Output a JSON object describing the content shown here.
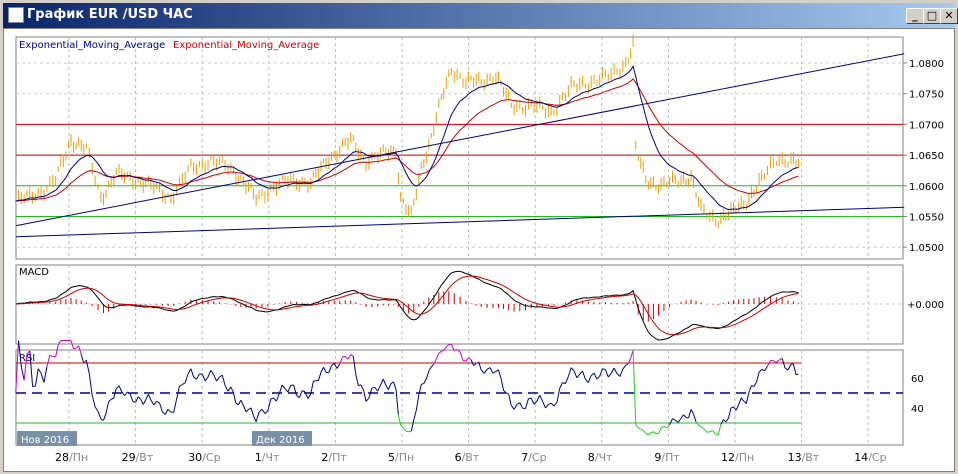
{
  "window": {
    "title": "График EUR /USD  ЧАС",
    "minimize": "_",
    "maximize": "□",
    "close": "✕"
  },
  "legend": {
    "ema_fast": "Exponential_Moving_Average",
    "ema_slow": "Exponential_Moving_Average"
  },
  "colors": {
    "price": "#e8a000",
    "ema_fast": "#000080",
    "ema_slow": "#cc0000",
    "resistance": "#cc0000",
    "support": "#22bb22",
    "trend": "#000080"
  },
  "chart_data": {
    "type": "line",
    "symbol": "EUR/USD",
    "timeframe": "H1",
    "price_ylim": [
      1.049,
      1.084
    ],
    "price_ticks": [
      "1.0800",
      "1.0750",
      "1.0700",
      "1.0650",
      "1.0600",
      "1.0550",
      "1.0500"
    ],
    "price_tick_values": [
      1.08,
      1.075,
      1.07,
      1.065,
      1.06,
      1.055,
      1.05
    ],
    "resistance_levels": [
      1.07,
      1.065
    ],
    "support_levels": [
      1.06,
      1.055
    ],
    "trendlines": [
      {
        "t": [
          -0.8,
          12.54
        ],
        "p": [
          1.0535,
          1.0815
        ]
      },
      {
        "t": [
          -0.8,
          12.54
        ],
        "p": [
          1.0517,
          1.0565
        ]
      }
    ],
    "price_t": [
      -0.8,
      -0.42,
      -0.2,
      0.03,
      0.26,
      0.48,
      0.71,
      1.0,
      1.23,
      1.53,
      1.83,
      2.13,
      2.43,
      2.58,
      2.81,
      3.03,
      3.33,
      3.63,
      3.86,
      4.23,
      4.46,
      4.68,
      4.91,
      4.98,
      5.14,
      5.29,
      5.44,
      5.59,
      5.74,
      5.96,
      6.19,
      6.41,
      6.64,
      6.94,
      7.24,
      7.54,
      7.84,
      8.14,
      8.36,
      8.47,
      8.51,
      8.66,
      8.89,
      9.19,
      9.34,
      9.49,
      9.71,
      9.94,
      10.17,
      10.4,
      10.62,
      10.84,
      10.99
    ],
    "price": [
      1.0575,
      1.059,
      1.061,
      1.0675,
      1.066,
      1.058,
      1.062,
      1.061,
      1.06,
      1.058,
      1.063,
      1.064,
      1.063,
      1.061,
      1.058,
      1.0595,
      1.061,
      1.0605,
      1.064,
      1.0675,
      1.064,
      1.065,
      1.066,
      1.058,
      1.055,
      1.063,
      1.068,
      1.074,
      1.079,
      1.077,
      1.077,
      1.078,
      1.073,
      1.073,
      1.072,
      1.076,
      1.077,
      1.078,
      1.08,
      1.083,
      1.066,
      1.061,
      1.06,
      1.061,
      1.0615,
      1.056,
      1.0545,
      1.0555,
      1.0575,
      1.061,
      1.0645,
      1.064,
      1.0635
    ],
    "macd": {
      "label": "MACD",
      "tick": "+0.000"
    },
    "rsi": {
      "label": "RSI",
      "ticks": [
        "60",
        "40"
      ],
      "tick_values": [
        60,
        40
      ],
      "overbought": 70,
      "oversold": 30,
      "mid": 50
    },
    "months": [
      "Нов 2016",
      "Дек 2016"
    ],
    "x_ticks": [
      {
        "d": "28",
        "w": "Пн"
      },
      {
        "d": "29",
        "w": "Вт"
      },
      {
        "d": "30",
        "w": "Ср"
      },
      {
        "d": "1",
        "w": "Чт"
      },
      {
        "d": "2",
        "w": "Пт"
      },
      {
        "d": "5",
        "w": "Пн"
      },
      {
        "d": "6",
        "w": "Вт"
      },
      {
        "d": "7",
        "w": "Ср"
      },
      {
        "d": "8",
        "w": "Чт"
      },
      {
        "d": "9",
        "w": "Пт"
      },
      {
        "d": "12",
        "w": "Пн"
      },
      {
        "d": "13",
        "w": "Вт"
      },
      {
        "d": "14",
        "w": "Ср"
      }
    ]
  }
}
